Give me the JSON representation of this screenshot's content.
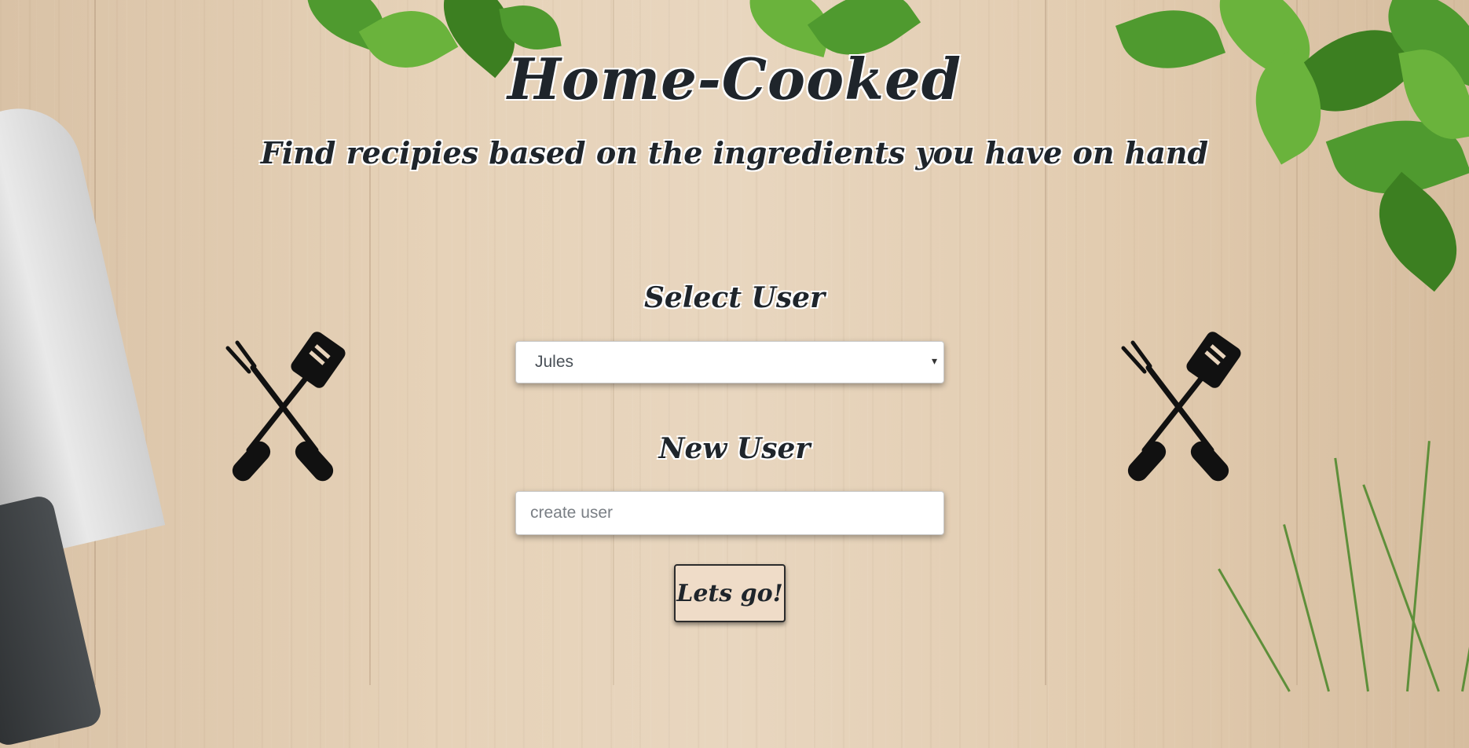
{
  "header": {
    "title": "Home-Cooked",
    "subtitle": "Find recipies based on the ingredients you have on hand"
  },
  "select_user": {
    "label": "Select User",
    "selected_value": "Jules",
    "arrow_glyph": "▾"
  },
  "new_user": {
    "label": "New User",
    "placeholder": "create user",
    "value": ""
  },
  "submit": {
    "label": "Lets go!"
  },
  "icons": {
    "left": "crossed-fork-spatula-icon",
    "right": "crossed-fork-spatula-icon"
  },
  "colors": {
    "text": "#1f252b",
    "button_bg": "#efdcc8",
    "wood": "#e6d2b8"
  }
}
